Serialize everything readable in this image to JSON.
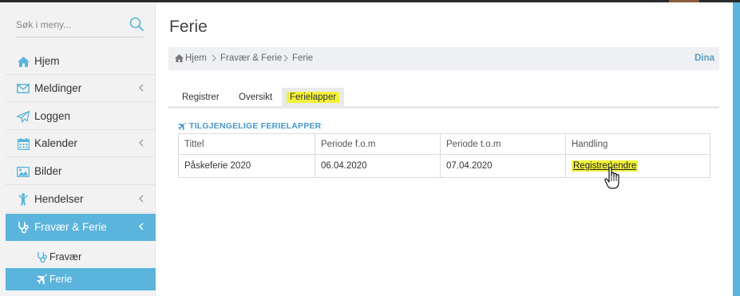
{
  "colors": {
    "accent": "#5ab4dc",
    "highlight": "#f2f23a",
    "heading": "#4a97c8",
    "sidebar_bg": "#f2f2f2",
    "breadcrumb_bg": "#eef0f3"
  },
  "search": {
    "placeholder": "Søk i meny...",
    "icon": "search-icon"
  },
  "sidebar": {
    "items": [
      {
        "label": "Hjem",
        "icon": "home-icon",
        "has_submenu": false,
        "active": false
      },
      {
        "label": "Meldinger",
        "icon": "envelope-icon",
        "has_submenu": true,
        "active": false
      },
      {
        "label": "Loggen",
        "icon": "paper-plane-icon",
        "has_submenu": false,
        "active": false
      },
      {
        "label": "Kalender",
        "icon": "calendar-icon",
        "has_submenu": true,
        "active": false
      },
      {
        "label": "Bilder",
        "icon": "image-icon",
        "has_submenu": false,
        "active": false
      },
      {
        "label": "Hendelser",
        "icon": "child-icon",
        "has_submenu": true,
        "active": false
      },
      {
        "label": "Fravær & Ferie",
        "icon": "stethoscope-icon",
        "has_submenu": true,
        "active": true
      }
    ],
    "subitems": [
      {
        "label": "Fravær",
        "icon": "stethoscope-icon",
        "active": false
      },
      {
        "label": "Ferie",
        "icon": "plane-icon",
        "active": true
      }
    ]
  },
  "page": {
    "title": "Ferie"
  },
  "breadcrumb": {
    "home_label": "Hjem",
    "items": [
      "Fravær & Ferie",
      "Ferie"
    ],
    "user": "Dina"
  },
  "tabs": [
    {
      "label": "Registrer",
      "active": false
    },
    {
      "label": "Oversikt",
      "active": false
    },
    {
      "label": "Ferielapper",
      "active": true
    }
  ],
  "section": {
    "heading": "TILGJENGELIGE FERIELAPPER",
    "icon": "plane-icon"
  },
  "table": {
    "columns": [
      "Tittel",
      "Periode f.o.m",
      "Periode t.o.m",
      "Handling"
    ],
    "rows": [
      {
        "title": "Påskeferie 2020",
        "from": "06.04.2020",
        "to": "07.04.2020",
        "action": "Registrer\\endre"
      }
    ]
  }
}
